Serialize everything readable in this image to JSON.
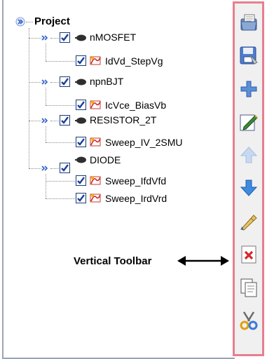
{
  "tree": {
    "root": {
      "label": "Project"
    },
    "nodes": [
      {
        "label": "nMOSFET",
        "checked": true,
        "children": [
          {
            "label": "IdVd_StepVg",
            "checked": true
          }
        ]
      },
      {
        "label": "npnBJT",
        "checked": true,
        "children": [
          {
            "label": "IcVce_BiasVb",
            "checked": true
          }
        ]
      },
      {
        "label": "RESISTOR_2T",
        "checked": true,
        "children": [
          {
            "label": "Sweep_IV_2SMU",
            "checked": true
          }
        ]
      },
      {
        "label": "DIODE",
        "checked": true,
        "children": [
          {
            "label": "Sweep_IfdVfd",
            "checked": true
          },
          {
            "label": "Sweep_IrdVrd",
            "checked": true
          }
        ]
      }
    ]
  },
  "annotation": {
    "text": "Vertical Toolbar"
  },
  "toolbar": {
    "border_color": "#e77f8e",
    "buttons": [
      {
        "icon": "open-project-icon"
      },
      {
        "icon": "save-project-icon"
      },
      {
        "icon": "add-icon"
      },
      {
        "icon": "edit-icon"
      },
      {
        "icon": "move-up-icon"
      },
      {
        "icon": "move-down-icon"
      },
      {
        "icon": "rename-icon"
      },
      {
        "icon": "delete-icon"
      },
      {
        "icon": "copy-icon"
      },
      {
        "icon": "cut-icon"
      }
    ]
  }
}
